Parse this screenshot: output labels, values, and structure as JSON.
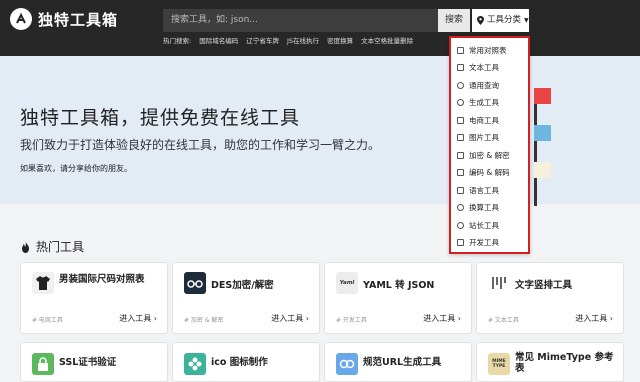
{
  "header": {
    "brand": "独特工具箱",
    "search_placeholder": "搜索工具，如: json...",
    "search_button": "搜索",
    "category_button": "工具分类",
    "hot_label": "热门搜索:",
    "hot_links": [
      "国际域名编码",
      "辽宁省车牌",
      "JS在线执行",
      "密度换算",
      "文本空格批量删除"
    ]
  },
  "hero": {
    "title": "独特工具箱，提供免费在线工具",
    "subtitle": "我们致力于打造体验良好的在线工具，助您的工作和学习一臂之力。",
    "share": "如果喜欢，请分享给你的朋友。"
  },
  "section": {
    "title": "热门工具"
  },
  "cards": [
    {
      "title": "男装国际尺码对照表",
      "tag": "# 电商工具",
      "go": "进入工具",
      "icon": "shirt-icon",
      "color": "#f0f0f0"
    },
    {
      "title": "DES加密/解密",
      "tag": "# 加密 & 解密",
      "go": "进入工具",
      "icon": "glasses-icon",
      "color": "#1e2b3a"
    },
    {
      "title": "YAML 转 JSON",
      "tag": "# 开发工具",
      "go": "进入工具",
      "icon": "yaml-icon",
      "color": "#ececec"
    },
    {
      "title": "文字竖排工具",
      "tag": "# 文本工具",
      "go": "进入工具",
      "icon": "vertical-text-icon",
      "color": "#ffffff"
    }
  ],
  "cards_row2": [
    {
      "title": "SSL证书验证",
      "icon": "lock-icon",
      "color": "#5cb85c"
    },
    {
      "title": "ico 图标制作",
      "icon": "flower-icon",
      "color": "#3ab39a"
    },
    {
      "title": "规范URL生成工具",
      "icon": "link-icon",
      "color": "#6aa7e8"
    },
    {
      "title": "常见 MimeType 参考表",
      "icon": "mime-icon",
      "color": "#e8d9a6"
    }
  ],
  "mime_badge": "MIME TYPE",
  "yaml_badge": "Yaml",
  "dropdown": [
    "常用对照表",
    "文本工具",
    "通用查询",
    "生成工具",
    "电商工具",
    "图片工具",
    "加密 & 解密",
    "编码 & 解码",
    "语言工具",
    "换算工具",
    "站长工具",
    "开发工具"
  ],
  "colors": {
    "topbar": "#272727",
    "hero": "#e3ebf5",
    "dropdown_border": "#d42020"
  }
}
